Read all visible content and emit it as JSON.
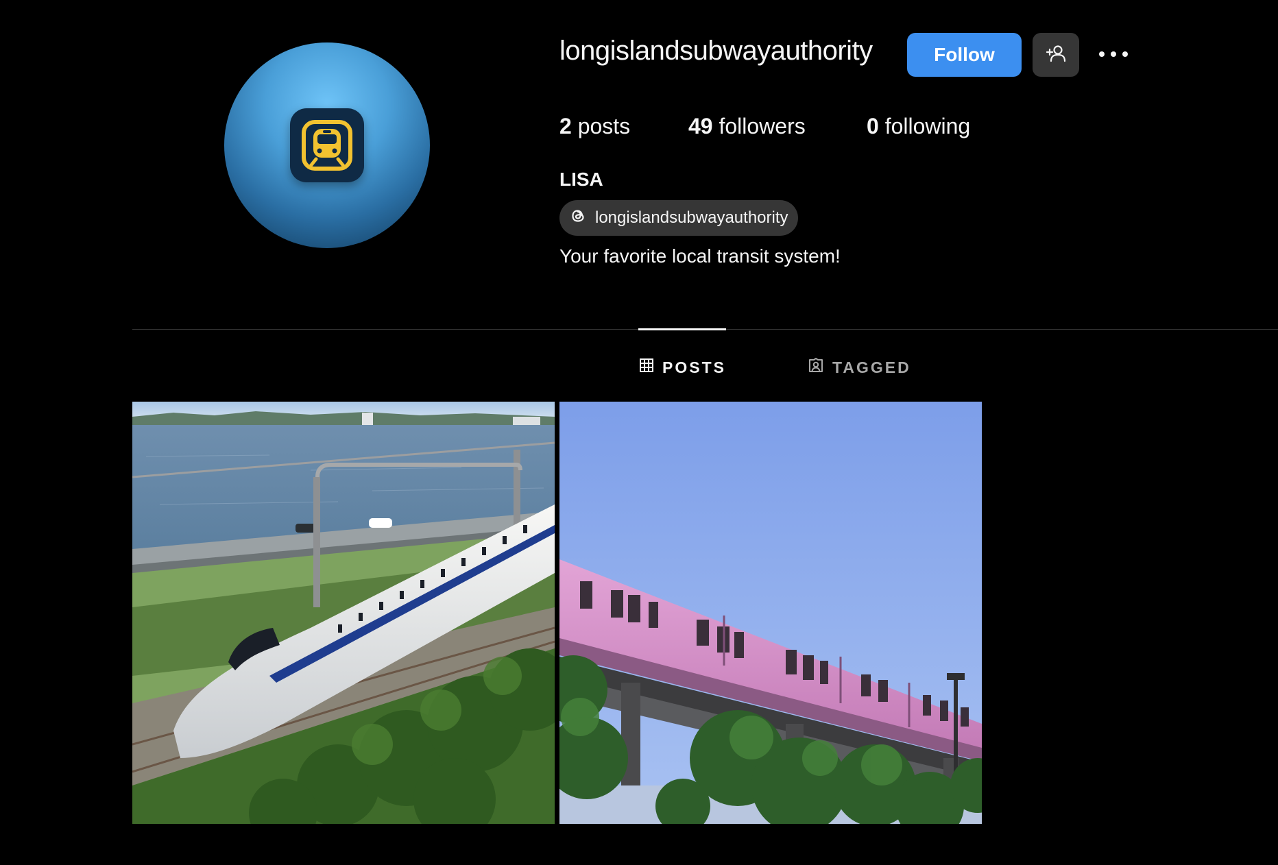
{
  "profile": {
    "username": "longislandsubwayauthority",
    "full_name": "LISA",
    "threads_handle": "longislandsubwayauthority",
    "bio": "Your favorite local transit system!",
    "avatar_icon": "train-icon"
  },
  "actions": {
    "follow_label": "Follow",
    "suggest_icon": "add-person-icon",
    "more_icon": "more-options-icon"
  },
  "stats": [
    {
      "count": "2",
      "label": "posts"
    },
    {
      "count": "49",
      "label": "followers"
    },
    {
      "count": "0",
      "label": "following"
    }
  ],
  "tabs": [
    {
      "label": "POSTS",
      "icon": "grid-icon",
      "active": true
    },
    {
      "label": "TAGGED",
      "icon": "tagged-icon",
      "active": false
    }
  ],
  "posts": [
    {
      "subject": "bullet-train-photo"
    },
    {
      "subject": "elevated-train-photo"
    }
  ],
  "colors": {
    "background": "#000000",
    "follow_button": "#3c8ff0",
    "secondary_button": "#363636",
    "text": "#f5f5f5",
    "muted_text": "#a8a8a8"
  }
}
